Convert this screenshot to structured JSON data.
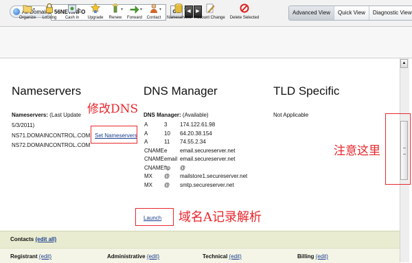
{
  "topbar": {
    "all_domains": "All Domains",
    "domain_value": "56NET.INFO",
    "go": "GO",
    "prev": "◀",
    "next": "▶",
    "views": [
      "Advanced View",
      "Quick View",
      "Diagnostic View"
    ],
    "active_view": "Advanced View"
  },
  "toolbar": {
    "items": [
      "Organize",
      "Locking",
      "Cash in",
      "Upgrade",
      "Renew",
      "Forward",
      "Contact",
      "Nameservers",
      "Account Change",
      "Delete Selected"
    ]
  },
  "nameservers": {
    "title": "Nameservers",
    "label": "Nameservers:",
    "update_a": "(Last Update",
    "update_b": "5/3/2011)",
    "ns1": "NS71.DOMAINCONTROL.COM",
    "ns2": "NS72.DOMAINCONTROL.COM",
    "set_link": "Set Nameservers"
  },
  "dns": {
    "title": "DNS Manager",
    "label": "DNS Manager:",
    "status": "(Available)",
    "records": [
      {
        "type": "A",
        "host": "3",
        "value": "174.122.61.98"
      },
      {
        "type": "A",
        "host": "10",
        "value": "64.20.38.154"
      },
      {
        "type": "A",
        "host": "11",
        "value": "74.55.2.34"
      },
      {
        "type": "CNAME",
        "host": "e",
        "value": "email.secureserver.net"
      },
      {
        "type": "CNAME",
        "host": "email",
        "value": "email.secureserver.net"
      },
      {
        "type": "CNAME",
        "host": "ftp",
        "value": "@"
      },
      {
        "type": "MX",
        "host": "@",
        "value": "mailstore1.secureserver.net"
      },
      {
        "type": "MX",
        "host": "@",
        "value": "smtp.secureserver.net"
      }
    ],
    "launch": "Launch"
  },
  "tld": {
    "title": "TLD Specific",
    "text": "Not Applicable"
  },
  "annotations": {
    "modify_dns": "修改DNS",
    "attention": "注意这里",
    "a_record": "域名A记录解析"
  },
  "contacts": {
    "title": "Contacts",
    "edit_all": "(edit all)",
    "roles": [
      "Registrant",
      "Administrative",
      "Technical",
      "Billing"
    ],
    "edit": "(edit)"
  },
  "colors": {
    "annotation_red": "#e8262c",
    "link_blue": "#1a3d8f",
    "contacts_bar": "#e9ecd0"
  }
}
